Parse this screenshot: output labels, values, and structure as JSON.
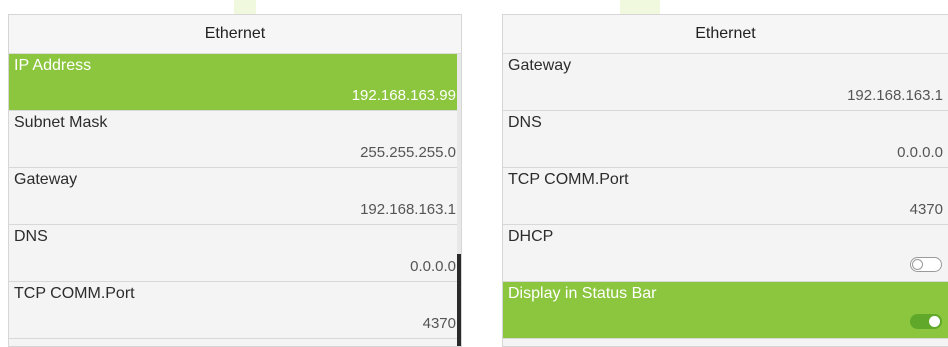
{
  "left_panel": {
    "title": "Ethernet",
    "rows": [
      {
        "label": "IP Address",
        "value": "192.168.163.99",
        "selected": true
      },
      {
        "label": "Subnet Mask",
        "value": "255.255.255.0",
        "selected": false
      },
      {
        "label": "Gateway",
        "value": "192.168.163.1",
        "selected": false
      },
      {
        "label": "DNS",
        "value": "0.0.0.0",
        "selected": false
      },
      {
        "label": "TCP COMM.Port",
        "value": "4370",
        "selected": false
      }
    ]
  },
  "right_panel": {
    "title": "Ethernet",
    "rows": [
      {
        "label": "Gateway",
        "value": "192.168.163.1",
        "selected": false
      },
      {
        "label": "DNS",
        "value": "0.0.0.0",
        "selected": false
      },
      {
        "label": "TCP COMM.Port",
        "value": "4370",
        "selected": false
      },
      {
        "label": "DHCP",
        "toggle": "off",
        "selected": false
      },
      {
        "label": "Display in Status Bar",
        "toggle": "on",
        "selected": true
      }
    ]
  },
  "colors": {
    "selected_row": "#8cc63f",
    "toggle_on": "#5fa82a",
    "panel_bg": "#f4f4f4"
  }
}
